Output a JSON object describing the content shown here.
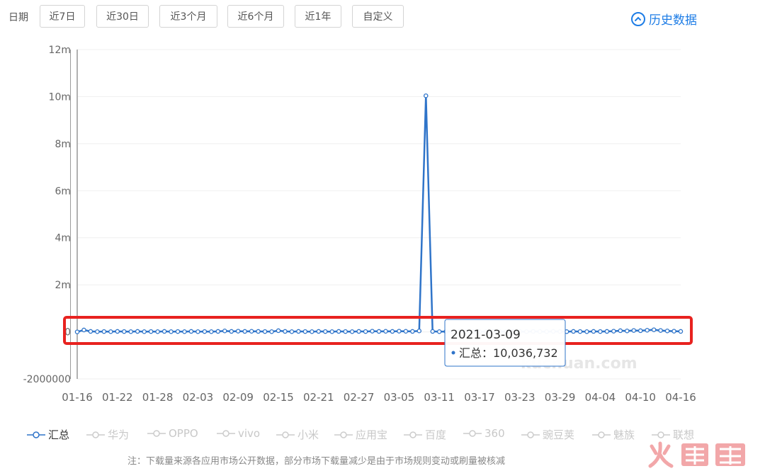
{
  "filters": {
    "date_label": "日期",
    "ranges": [
      {
        "label": "近7日",
        "active": false
      },
      {
        "label": "近30日",
        "active": false
      },
      {
        "label": "近3个月",
        "active": true
      },
      {
        "label": "近6个月",
        "active": false
      },
      {
        "label": "近1年",
        "active": false
      },
      {
        "label": "自定义",
        "active": false
      }
    ]
  },
  "history_link": "历史数据",
  "accent": "#1e7de6",
  "highlight_box_color": "#e8221f",
  "chart_data": {
    "type": "line",
    "title": "",
    "xlabel": "",
    "ylabel": "",
    "ylim": [
      -2000000,
      12000000
    ],
    "y_ticks": [
      {
        "value": -2000000,
        "label": "-2000000"
      },
      {
        "value": 0,
        "label": "0"
      },
      {
        "value": 2000000,
        "label": "2m"
      },
      {
        "value": 4000000,
        "label": "4m"
      },
      {
        "value": 6000000,
        "label": "6m"
      },
      {
        "value": 8000000,
        "label": "8m"
      },
      {
        "value": 10000000,
        "label": "10m"
      },
      {
        "value": 12000000,
        "label": "12m"
      }
    ],
    "x_tick_labels": [
      "01-16",
      "01-22",
      "01-28",
      "02-03",
      "02-09",
      "02-15",
      "02-21",
      "02-27",
      "03-05",
      "03-11",
      "03-17",
      "03-23",
      "03-29",
      "04-04",
      "04-10",
      "04-16"
    ],
    "grid": true,
    "legend_position": "bottom",
    "tooltip": {
      "date": "2021-03-09",
      "series": "汇总",
      "value_text": "10,036,732"
    },
    "series": [
      {
        "name": "汇总",
        "color": "#2f74c9",
        "active": true,
        "points": [
          [
            "01-16",
            0
          ],
          [
            "01-17",
            80000
          ],
          [
            "01-18",
            20000
          ],
          [
            "01-19",
            10000
          ],
          [
            "01-20",
            15000
          ],
          [
            "01-21",
            10000
          ],
          [
            "01-22",
            20000
          ],
          [
            "01-23",
            15000
          ],
          [
            "01-24",
            10000
          ],
          [
            "01-25",
            20000
          ],
          [
            "01-26",
            10000
          ],
          [
            "01-27",
            15000
          ],
          [
            "01-28",
            10000
          ],
          [
            "01-29",
            20000
          ],
          [
            "01-30",
            10000
          ],
          [
            "01-31",
            15000
          ],
          [
            "02-01",
            10000
          ],
          [
            "02-02",
            20000
          ],
          [
            "02-03",
            10000
          ],
          [
            "02-04",
            15000
          ],
          [
            "02-05",
            10000
          ],
          [
            "02-06",
            20000
          ],
          [
            "02-07",
            40000
          ],
          [
            "02-08",
            20000
          ],
          [
            "02-09",
            30000
          ],
          [
            "02-10",
            20000
          ],
          [
            "02-11",
            25000
          ],
          [
            "02-12",
            20000
          ],
          [
            "02-13",
            15000
          ],
          [
            "02-14",
            10000
          ],
          [
            "02-15",
            50000
          ],
          [
            "02-16",
            20000
          ],
          [
            "02-17",
            10000
          ],
          [
            "02-18",
            20000
          ],
          [
            "02-19",
            15000
          ],
          [
            "02-20",
            10000
          ],
          [
            "02-21",
            20000
          ],
          [
            "02-22",
            15000
          ],
          [
            "02-23",
            10000
          ],
          [
            "02-24",
            20000
          ],
          [
            "02-25",
            15000
          ],
          [
            "02-26",
            10000
          ],
          [
            "02-27",
            20000
          ],
          [
            "02-28",
            15000
          ],
          [
            "03-01",
            30000
          ],
          [
            "03-02",
            20000
          ],
          [
            "03-03",
            25000
          ],
          [
            "03-04",
            20000
          ],
          [
            "03-05",
            30000
          ],
          [
            "03-06",
            25000
          ],
          [
            "03-07",
            20000
          ],
          [
            "03-08",
            40000
          ],
          [
            "03-09",
            10036732
          ],
          [
            "03-10",
            20000
          ],
          [
            "03-11",
            10000
          ],
          [
            "03-12",
            15000
          ],
          [
            "03-13",
            10000
          ],
          [
            "03-14",
            20000
          ],
          [
            "03-15",
            10000
          ],
          [
            "03-16",
            15000
          ],
          [
            "03-17",
            10000
          ],
          [
            "03-18",
            15000
          ],
          [
            "03-19",
            20000
          ],
          [
            "03-20",
            15000
          ],
          [
            "03-21",
            10000
          ],
          [
            "03-22",
            20000
          ],
          [
            "03-23",
            15000
          ],
          [
            "03-24",
            10000
          ],
          [
            "03-25",
            20000
          ],
          [
            "03-26",
            15000
          ],
          [
            "03-27",
            10000
          ],
          [
            "03-28",
            20000
          ],
          [
            "03-29",
            15000
          ],
          [
            "03-30",
            10000
          ],
          [
            "03-31",
            20000
          ],
          [
            "04-01",
            15000
          ],
          [
            "04-02",
            10000
          ],
          [
            "04-03",
            20000
          ],
          [
            "04-04",
            15000
          ],
          [
            "04-05",
            20000
          ],
          [
            "04-06",
            30000
          ],
          [
            "04-07",
            50000
          ],
          [
            "04-08",
            40000
          ],
          [
            "04-09",
            60000
          ],
          [
            "04-10",
            50000
          ],
          [
            "04-11",
            70000
          ],
          [
            "04-12",
            90000
          ],
          [
            "04-13",
            60000
          ],
          [
            "04-14",
            40000
          ],
          [
            "04-15",
            30000
          ],
          [
            "04-16",
            20000
          ]
        ]
      },
      {
        "name": "华为",
        "active": false,
        "points": []
      },
      {
        "name": "OPPO",
        "active": false,
        "points": []
      },
      {
        "name": "vivo",
        "active": false,
        "points": []
      },
      {
        "name": "小米",
        "active": false,
        "points": []
      },
      {
        "name": "应用宝",
        "active": false,
        "points": []
      },
      {
        "name": "百度",
        "active": false,
        "points": []
      },
      {
        "name": "360",
        "active": false,
        "points": []
      },
      {
        "name": "豌豆荚",
        "active": false,
        "points": []
      },
      {
        "name": "魅族",
        "active": false,
        "points": []
      },
      {
        "name": "联想",
        "active": false,
        "points": []
      }
    ]
  },
  "watermark": "kuchuan.com",
  "note": "注：下载量来源各应用市场公开数据，部分市场下载量减少是由于市场规则变动或刷量被核减",
  "brand_logo_text": "火鲤鱼"
}
